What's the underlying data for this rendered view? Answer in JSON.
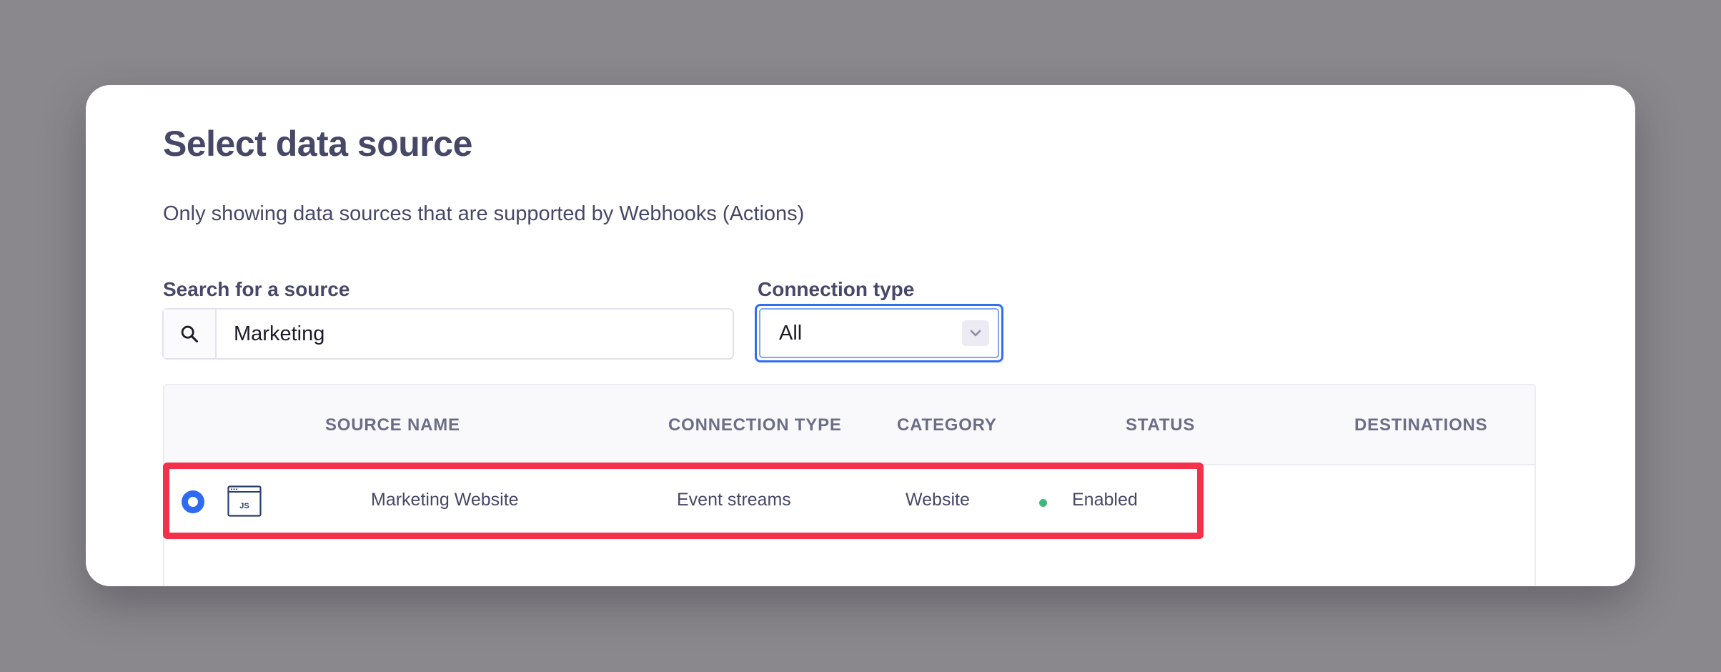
{
  "modal": {
    "title": "Select data source",
    "subtitle": "Only showing data sources that are supported by Webhooks (Actions)"
  },
  "search": {
    "label": "Search for a source",
    "value": "Marketing",
    "icon": "search-icon"
  },
  "connection_type": {
    "label": "Connection type",
    "selected": "All",
    "icon": "chevron-down-icon"
  },
  "table": {
    "columns": [
      "SOURCE NAME",
      "CONNECTION TYPE",
      "CATEGORY",
      "STATUS",
      "DESTINATIONS"
    ],
    "rows": [
      {
        "selected": true,
        "icon": "javascript-source-icon",
        "icon_text": "JS",
        "name": "Marketing Website",
        "connection_type": "Event streams",
        "category": "Website",
        "status": "Enabled",
        "status_color": "#3fb87c",
        "destinations": ""
      }
    ]
  },
  "colors": {
    "accent": "#2e6bf0",
    "highlight": "#f4304a",
    "text": "#474867"
  }
}
